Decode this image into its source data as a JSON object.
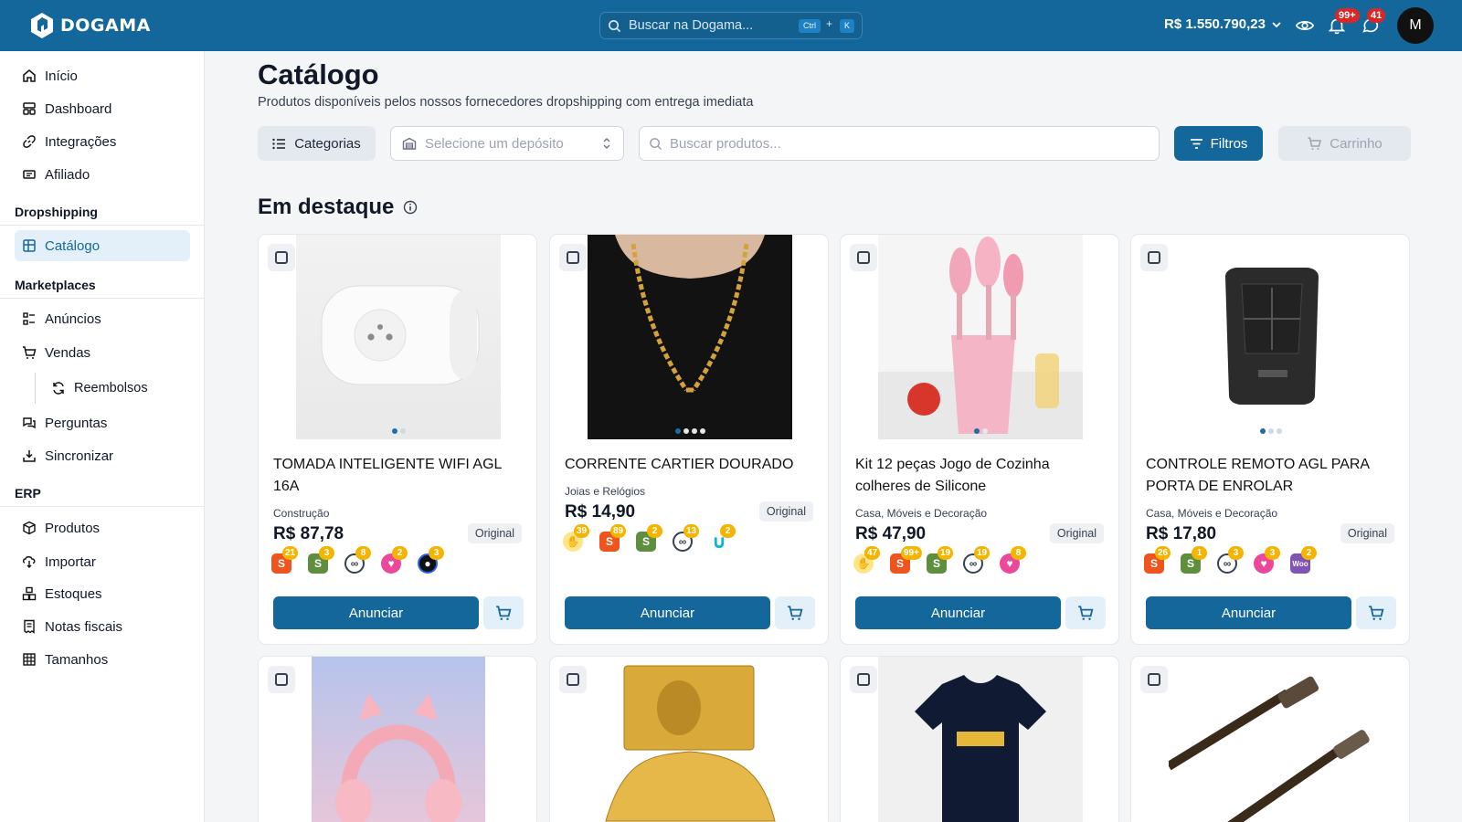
{
  "brand": {
    "name": "DOGAMA"
  },
  "header": {
    "search_placeholder": "Buscar na Dogama...",
    "shortcut_ctrl": "Ctrl",
    "shortcut_plus": "+",
    "shortcut_key": "K",
    "balance": "R$ 1.550.790,23",
    "notifications_badge": "99+",
    "messages_badge": "41",
    "avatar_initial": "M"
  },
  "sidebar": {
    "items": [
      "Início",
      "Dashboard",
      "Integrações",
      "Afiliado"
    ],
    "dropshipping_title": "Dropshipping",
    "dropshipping_items": [
      "Catálogo"
    ],
    "marketplaces_title": "Marketplaces",
    "marketplaces_items": [
      "Anúncios",
      "Vendas",
      "Reembolsos",
      "Perguntas",
      "Sincronizar"
    ],
    "erp_title": "ERP",
    "erp_items": [
      "Produtos",
      "Importar",
      "Estoques",
      "Notas fiscais",
      "Tamanhos"
    ]
  },
  "page": {
    "title": "Catálogo",
    "subtitle": "Produtos disponíveis pelos nossos fornecedores dropshipping com entrega imediata",
    "categories_label": "Categorias",
    "deposit_placeholder": "Selecione um depósito",
    "search_placeholder": "Buscar produtos...",
    "filters_label": "Filtros",
    "cart_label": "Carrinho",
    "featured_title": "Em destaque"
  },
  "product_labels": {
    "original": "Original",
    "announce": "Anunciar"
  },
  "products": [
    {
      "name": "TOMADA INTELIGENTE WIFI AGL 16A",
      "category": "Construção",
      "price": "R$ 87,78",
      "marketplaces": [
        {
          "icon": "shopee",
          "count": "21"
        },
        {
          "icon": "shopify",
          "count": "3"
        },
        {
          "icon": "links",
          "count": "8"
        },
        {
          "icon": "heart",
          "count": "2"
        },
        {
          "icon": "panda",
          "count": "3"
        }
      ]
    },
    {
      "name": "CORRENTE CARTIER DOURADO",
      "category": "Joias e Relógios",
      "price": "R$ 14,90",
      "marketplaces": [
        {
          "icon": "handshake",
          "count": "39"
        },
        {
          "icon": "shopee",
          "count": "89"
        },
        {
          "icon": "shopify",
          "count": "2"
        },
        {
          "icon": "links",
          "count": "13"
        },
        {
          "icon": "magnet",
          "count": "2"
        }
      ]
    },
    {
      "name": "Kit 12 peças Jogo de Cozinha colheres de Silicone",
      "category": "Casa, Móveis e Decoração",
      "price": "R$ 47,90",
      "marketplaces": [
        {
          "icon": "handshake",
          "count": "47"
        },
        {
          "icon": "shopee",
          "count": "99+"
        },
        {
          "icon": "shopify",
          "count": "19"
        },
        {
          "icon": "links",
          "count": "19"
        },
        {
          "icon": "heart",
          "count": "8"
        }
      ]
    },
    {
      "name": "CONTROLE REMOTO AGL PARA PORTA DE ENROLAR",
      "category": "Casa, Móveis e Decoração",
      "price": "R$ 17,80",
      "marketplaces": [
        {
          "icon": "shopee",
          "count": "26"
        },
        {
          "icon": "shopify",
          "count": "1"
        },
        {
          "icon": "links",
          "count": "3"
        },
        {
          "icon": "heart",
          "count": "3"
        },
        {
          "icon": "woo",
          "count": "2"
        }
      ]
    }
  ],
  "colors": {
    "primary": "#14679a",
    "badge": "#dc2626",
    "count_badge": "#f5b400"
  }
}
